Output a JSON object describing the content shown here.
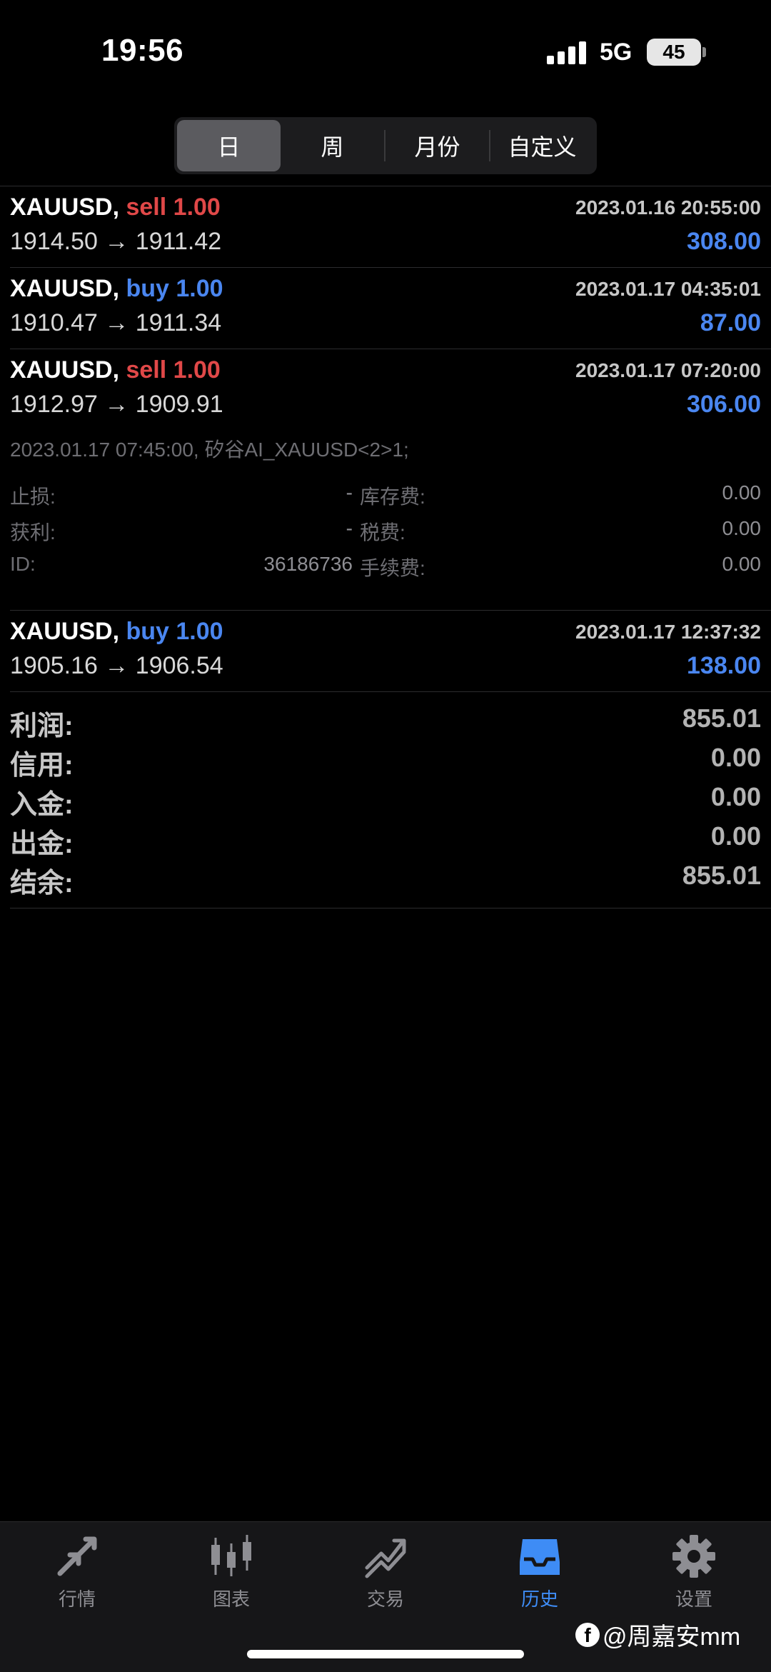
{
  "status_bar": {
    "time": "19:56",
    "network": "5G",
    "battery": "45"
  },
  "segments": [
    {
      "label": "日",
      "active": true
    },
    {
      "label": "周",
      "active": false
    },
    {
      "label": "月份",
      "active": false
    },
    {
      "label": "自定义",
      "active": false
    }
  ],
  "deals": [
    {
      "symbol": "XAUUSD,",
      "side": "sell",
      "volume": "1.00",
      "time": "2023.01.16 20:55:00",
      "prices": "1914.50 → 1911.42",
      "profit": "308.00"
    },
    {
      "symbol": "XAUUSD,",
      "side": "buy",
      "volume": "1.00",
      "time": "2023.01.17 04:35:01",
      "prices": "1910.47 → 1911.34",
      "profit": "87.00"
    },
    {
      "symbol": "XAUUSD,",
      "side": "sell",
      "volume": "1.00",
      "time": "2023.01.17 07:20:00",
      "prices": "1912.97 → 1909.91",
      "profit": "306.00"
    },
    {
      "symbol": "XAUUSD,",
      "side": "buy",
      "volume": "1.00",
      "time": "2023.01.17 12:37:32",
      "prices": "1905.16 → 1906.54",
      "profit": "138.00"
    }
  ],
  "details": {
    "comment": "2023.01.17 07:45:00, 矽谷AI_XAUUSD<2>1;",
    "rows": [
      {
        "k1": "止损:",
        "v1": "-",
        "k2": "库存费:",
        "v2": "0.00"
      },
      {
        "k1": "获利:",
        "v1": "-",
        "k2": "税费:",
        "v2": "0.00"
      },
      {
        "k1": "ID:",
        "v1": "36186736",
        "k2": "手续费:",
        "v2": "0.00"
      }
    ]
  },
  "summary": [
    {
      "label": "利润:",
      "value": "855.01"
    },
    {
      "label": "信用:",
      "value": "0.00"
    },
    {
      "label": "入金:",
      "value": "0.00"
    },
    {
      "label": "出金:",
      "value": "0.00"
    },
    {
      "label": "结余:",
      "value": "855.01"
    }
  ],
  "tabs": [
    {
      "label": "行情",
      "icon": "quotes-arrows-icon",
      "active": false
    },
    {
      "label": "图表",
      "icon": "candlestick-chart-icon",
      "active": false
    },
    {
      "label": "交易",
      "icon": "trade-trend-icon",
      "active": false
    },
    {
      "label": "历史",
      "icon": "inbox-tray-icon",
      "active": true
    },
    {
      "label": "设置",
      "icon": "gear-icon",
      "active": false
    }
  ],
  "watermark": "@周嘉安mm",
  "colors": {
    "sell": "#e04848",
    "buy": "#4a86f0",
    "profit": "#4a86f0",
    "active_tab": "#3e8cf5"
  }
}
